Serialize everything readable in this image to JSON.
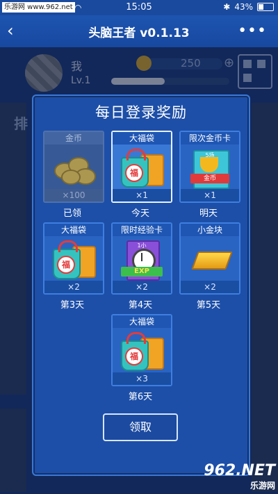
{
  "status_bar": {
    "watermark": "乐游网 www.962.net",
    "time": "15:05",
    "battery": "43%",
    "battery_fraction": 0.43
  },
  "nav": {
    "title": "头脑王者 v0.1.13",
    "back_icon": "back-arrow-icon",
    "more_icon": "more-dots-icon",
    "more_glyph": "•••",
    "back_glyph": "‹"
  },
  "profile": {
    "name": "我",
    "level": "Lv.1",
    "coins": "250",
    "plus": "⊕",
    "xp_fraction": 0.45,
    "side_text": "排"
  },
  "modal": {
    "title": "每日登录奖励",
    "claim_label": "领取",
    "rewards": [
      {
        "name": "金币",
        "qty": "×100",
        "day": "已领",
        "state": "claimed",
        "art": "coins"
      },
      {
        "name": "大福袋",
        "qty": "×1",
        "day": "今天",
        "state": "selected",
        "art": "bag"
      },
      {
        "name": "限次金币卡",
        "qty": "×1",
        "day": "明天",
        "state": "normal",
        "art": "trophy"
      },
      {
        "name": "大福袋",
        "qty": "×2",
        "day": "第3天",
        "state": "normal",
        "art": "bag"
      },
      {
        "name": "限时经验卡",
        "qty": "×2",
        "day": "第4天",
        "state": "normal",
        "art": "exp"
      },
      {
        "name": "小金块",
        "qty": "×2",
        "day": "第5天",
        "state": "normal",
        "art": "gold"
      },
      {
        "name": "大福袋",
        "qty": "×3",
        "day": "第6天",
        "state": "normal",
        "art": "bag"
      }
    ],
    "bag_char": "福",
    "trophy_ribbon": "金币",
    "trophy_top": "5场",
    "exp_ribbon": "EXP",
    "exp_top": "1小时"
  },
  "footer": {
    "brand": "962.NET",
    "brand_sub": "乐游网"
  }
}
